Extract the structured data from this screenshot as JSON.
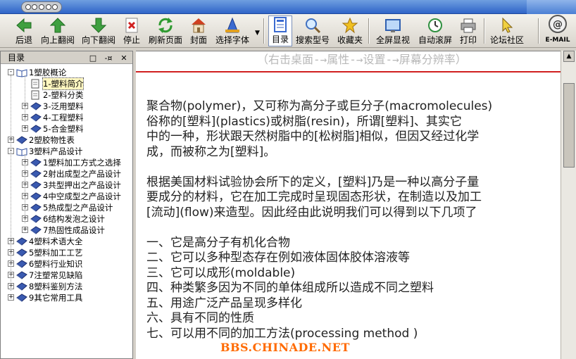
{
  "toolbar": {
    "buttons": [
      {
        "label": "后退",
        "icon": "back-arrow-icon"
      },
      {
        "label": "向上翻阅",
        "icon": "up-arrow-icon"
      },
      {
        "label": "向下翻阅",
        "icon": "down-arrow-icon"
      },
      {
        "label": "停止",
        "icon": "stop-icon"
      },
      {
        "label": "刷新页面",
        "icon": "refresh-icon"
      },
      {
        "label": "封面",
        "icon": "home-icon"
      },
      {
        "label": "选择字体",
        "icon": "font-icon"
      },
      {
        "label": "目录",
        "icon": "toc-icon"
      },
      {
        "label": "搜索型号",
        "icon": "search-icon"
      },
      {
        "label": "收藏夹",
        "icon": "favorites-star-icon"
      },
      {
        "label": "全屏显视",
        "icon": "fullscreen-icon"
      },
      {
        "label": "自动滚屏",
        "icon": "autoscroll-icon"
      },
      {
        "label": "打印",
        "icon": "printer-icon"
      },
      {
        "label": "论坛社区",
        "icon": "forum-pointer-icon"
      },
      {
        "label": "E-MAIL",
        "icon": "email-icon"
      }
    ]
  },
  "sidebar": {
    "title": "目录",
    "controls": [
      "□",
      "-¤",
      "✕"
    ],
    "tree": [
      {
        "label": "1塑胶概论",
        "level": 0,
        "type": "book-open",
        "expander": "-"
      },
      {
        "label": "1-塑料简介",
        "level": 1,
        "type": "page",
        "selected": true
      },
      {
        "label": "2-塑料分类",
        "level": 1,
        "type": "page"
      },
      {
        "label": "3-泛用塑料",
        "level": 1,
        "type": "book",
        "expander": "+"
      },
      {
        "label": "4-工程塑料",
        "level": 1,
        "type": "book",
        "expander": "+"
      },
      {
        "label": "5-合金塑料",
        "level": 1,
        "type": "book",
        "expander": "+"
      },
      {
        "label": "2塑胶物性表",
        "level": 0,
        "type": "book",
        "expander": "+"
      },
      {
        "label": "3塑料产品设计",
        "level": 0,
        "type": "book-open",
        "expander": "-"
      },
      {
        "label": "1塑料加工方式之选择",
        "level": 1,
        "type": "book",
        "expander": "+"
      },
      {
        "label": "2射出成型之产品设计",
        "level": 1,
        "type": "book",
        "expander": "+"
      },
      {
        "label": "3共型押出之产品设计",
        "level": 1,
        "type": "book",
        "expander": "+"
      },
      {
        "label": "4中空成型之产品设计",
        "level": 1,
        "type": "book",
        "expander": "+"
      },
      {
        "label": "5热成型之产品设计",
        "level": 1,
        "type": "book",
        "expander": "+"
      },
      {
        "label": "6结构发泡之设计",
        "level": 1,
        "type": "book",
        "expander": "+"
      },
      {
        "label": "7热固性成品设计",
        "level": 1,
        "type": "book",
        "expander": "+"
      },
      {
        "label": "4塑料术语大全",
        "level": 0,
        "type": "book",
        "expander": "+"
      },
      {
        "label": "5塑料加工工艺",
        "level": 0,
        "type": "book",
        "expander": "+"
      },
      {
        "label": "6塑料行业知识",
        "level": 0,
        "type": "book",
        "expander": "+"
      },
      {
        "label": "7注塑常见缺陷",
        "level": 0,
        "type": "book",
        "expander": "+"
      },
      {
        "label": "8塑料鉴别方法",
        "level": 0,
        "type": "book",
        "expander": "+"
      },
      {
        "label": "9其它常用工具",
        "level": 0,
        "type": "book",
        "expander": "+"
      }
    ]
  },
  "content": {
    "hint": "（右击桌面-→属性-→设置-→屏幕分辨率）",
    "lines": [
      "聚合物(polymer)，又可称为高分子或巨分子(macromolecules)",
      "俗称的[塑料](plastics)或树脂(resin)，所谓[塑料]、其实它",
      "中的一种，形状跟天然树脂中的[松树脂]相似，但因又经过化学",
      "成，而被称之为[塑料]。",
      "",
      "根据美国材料试验协会所下的定义，[塑料]乃是一种以高分子量",
      "要成分的材料，它在加工完成时呈现固态形状，在制造以及加工",
      "[流动](flow)来造型。因此经由此说明我们可以得到以下几项了",
      "",
      "一、它是高分子有机化合物",
      "二、它可以多种型态存在例如液体固体胶体溶液等",
      "三、它可以成形(moldable)",
      "四、种类繁多因为不同的单体组成所以造成不同之塑料",
      "五、用途广泛产品呈现多样化",
      "六、具有不同的性质",
      "七、可以用不同的加工方法(processing method )"
    ],
    "watermark": "BBS.CHINADE.NET"
  },
  "colors": {
    "accent_line": "#d02020",
    "watermark": "#ff6a00",
    "titlebar": "#2f64c8"
  }
}
